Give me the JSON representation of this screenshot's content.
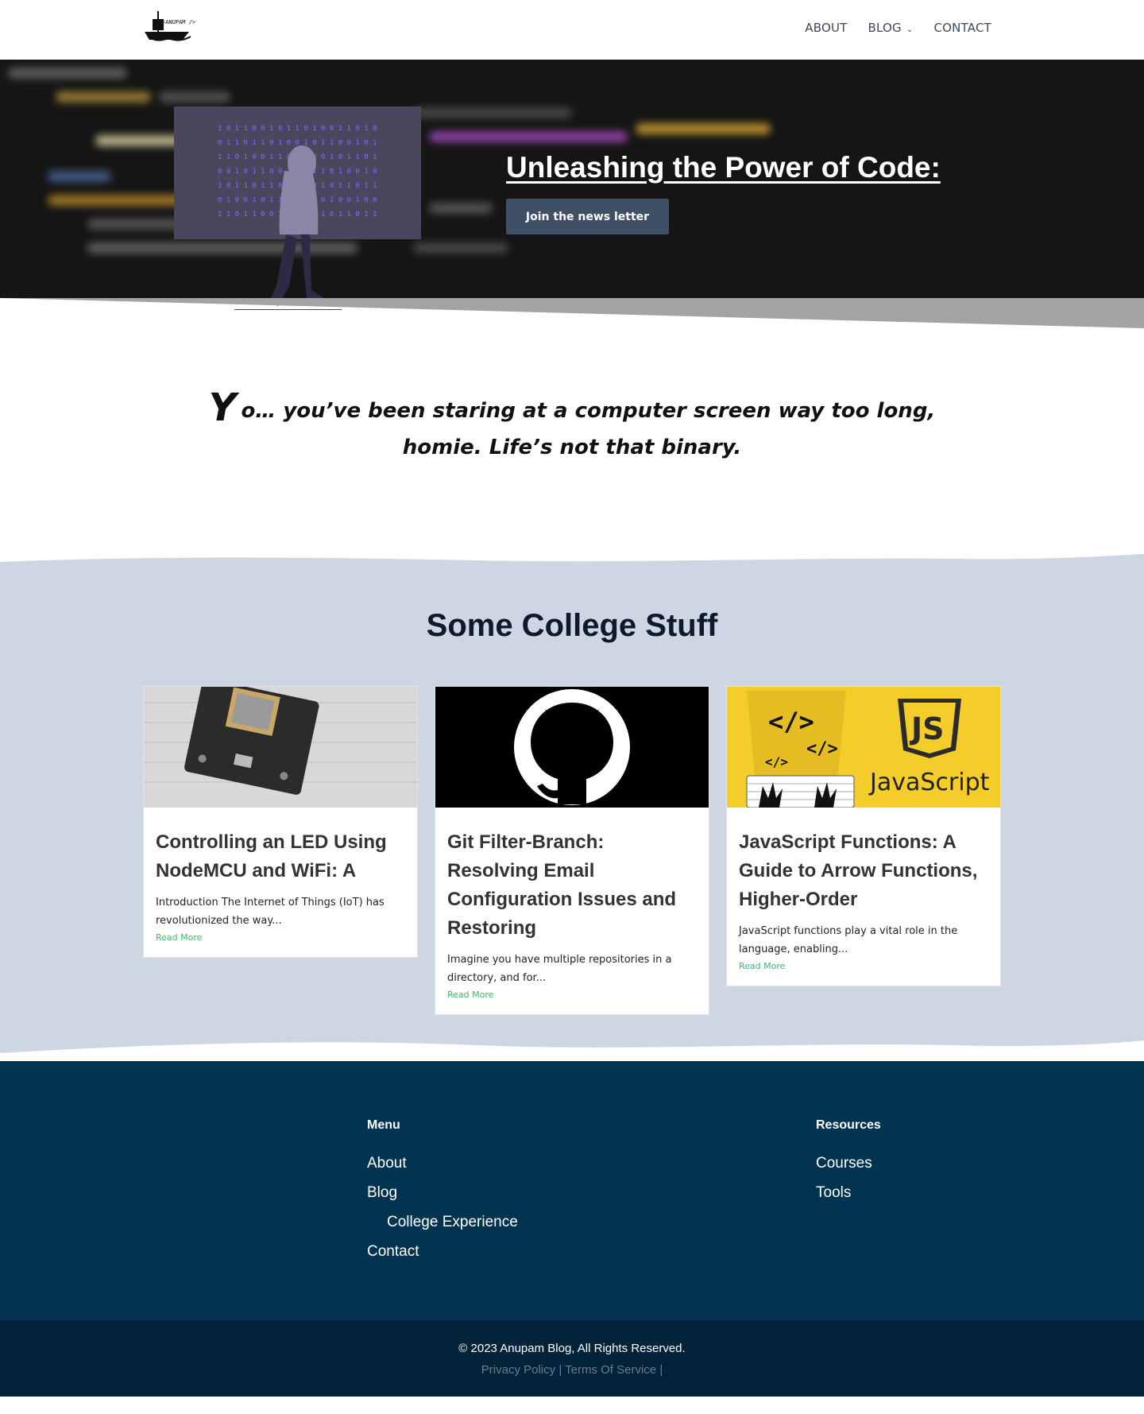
{
  "header": {
    "logo_text": "<ANUPAM />",
    "nav": [
      {
        "label": "ABOUT"
      },
      {
        "label": "BLOG",
        "has_dropdown": true
      },
      {
        "label": "CONTACT"
      }
    ]
  },
  "hero": {
    "title": "Unleashing the Power of Code:",
    "button_label": "Join the news letter"
  },
  "quote": {
    "dropcap": "Y",
    "text": "o… you’ve been staring at a computer screen way too long, homie. Life’s not that binary."
  },
  "college": {
    "title": "Some College Stuff",
    "cards": [
      {
        "title": "Controlling an LED Using NodeMCU and WiFi: A",
        "excerpt": "Introduction The Internet of Things (IoT) has revolutionized the way...",
        "read_more": "Read More",
        "image_icon": "nodemcu-board"
      },
      {
        "title": "Git Filter-Branch: Resolving Email Configuration Issues and Restoring",
        "excerpt": "Imagine you have multiple repositories in a directory, and for...",
        "read_more": "Read More",
        "image_icon": "github-octocat"
      },
      {
        "title": "JavaScript Functions: A Guide to Arrow Functions, Higher-Order",
        "excerpt": "JavaScript functions play a vital role in the language, enabling...",
        "read_more": "Read More",
        "image_icon": "javascript-banner",
        "image_text": "JavaScript",
        "badge_text": "JS"
      }
    ]
  },
  "footer": {
    "menu": {
      "heading": "Menu",
      "items": [
        "About",
        "Blog",
        "College Experience",
        "Contact"
      ]
    },
    "resources": {
      "heading": "Resources",
      "items": [
        "Courses",
        "Tools"
      ]
    },
    "copyright": "© 2023 Anupam Blog, All Rights Reserved.",
    "legal": [
      "Privacy Policy",
      "Terms Of Service"
    ]
  },
  "colors": {
    "accent": "#3bb86b",
    "hero_button": "#3f4f66",
    "section_bg": "#cdd6e2",
    "footer_bg": "#023351",
    "bottom_bar_bg": "#02233a"
  }
}
